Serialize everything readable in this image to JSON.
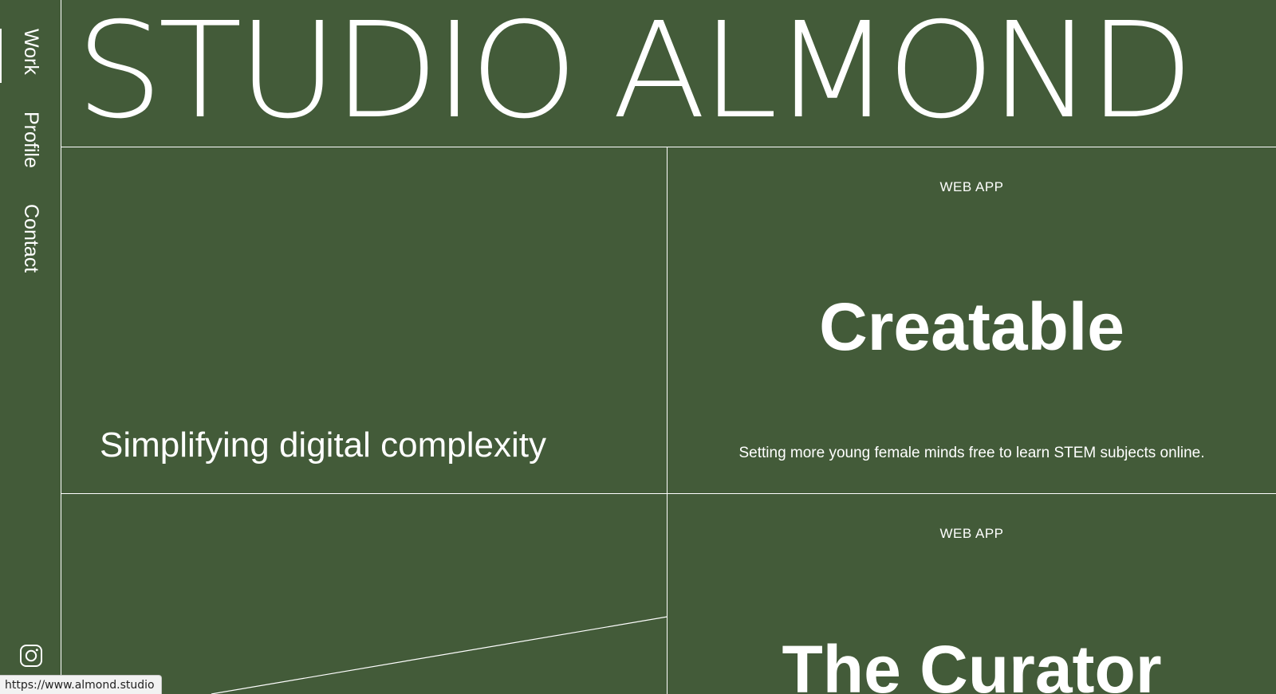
{
  "site": {
    "logo": "STUDIO ALMOND",
    "tagline": "Simplifying digital complexity"
  },
  "nav": {
    "items": [
      {
        "label": "Work",
        "active": true
      },
      {
        "label": "Profile",
        "active": false
      },
      {
        "label": "Contact",
        "active": false
      }
    ],
    "social_icon": "instagram-icon"
  },
  "projects": [
    {
      "category": "WEB APP",
      "title": "Creatable",
      "description": "Setting more young female minds free to learn STEM subjects online."
    },
    {
      "category": "WEB APP",
      "title": "The Curator"
    }
  ],
  "status_bar": {
    "url": "https://www.almond.studio"
  },
  "colors": {
    "background": "#435b39",
    "foreground": "#ffffff"
  }
}
